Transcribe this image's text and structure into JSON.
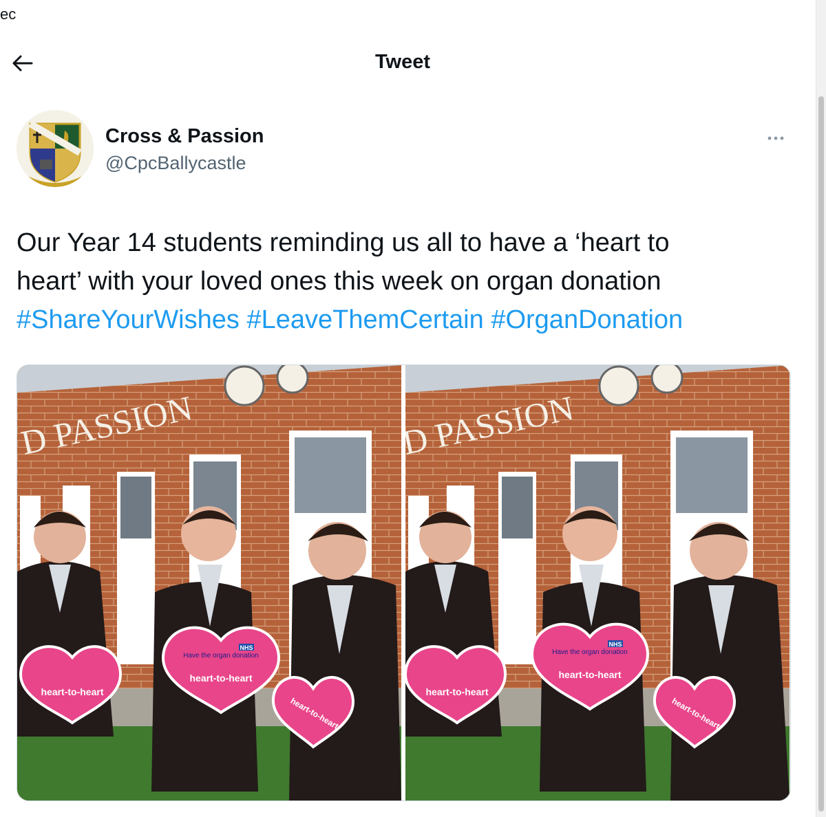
{
  "corner_text": "ec",
  "header": {
    "title": "Tweet",
    "back_icon": "arrow-left-icon"
  },
  "tweet": {
    "author": {
      "name": "Cross & Passion",
      "handle": "@CpcBallycastle",
      "avatar": "school-crest"
    },
    "more_icon": "more-horizontal-icon",
    "text_lines": [
      "Our Year 14 students reminding us all to have a ‘heart to",
      "heart’ with your loved ones this week on organ donation"
    ],
    "hashtags": [
      "#ShareYourWishes",
      "#LeaveThemCertain",
      "#OrganDonation"
    ],
    "media": [
      {
        "sign_text": "D PASSION",
        "heart_labels": [
          "heart-to-heart",
          "heart-to-heart",
          "heart-to-heart"
        ],
        "heart_small_text": "Have the organ donation",
        "badge": "NHS"
      },
      {
        "sign_text": "D PASSION",
        "heart_labels": [
          "heart-to-heart",
          "heart-to-heart",
          "heart-to-heart"
        ],
        "heart_small_text": "Have the organ donation",
        "badge": "NHS"
      }
    ]
  },
  "colors": {
    "link": "#1d9bf0",
    "secondary_text": "#536471",
    "brick": "#b5623a"
  }
}
